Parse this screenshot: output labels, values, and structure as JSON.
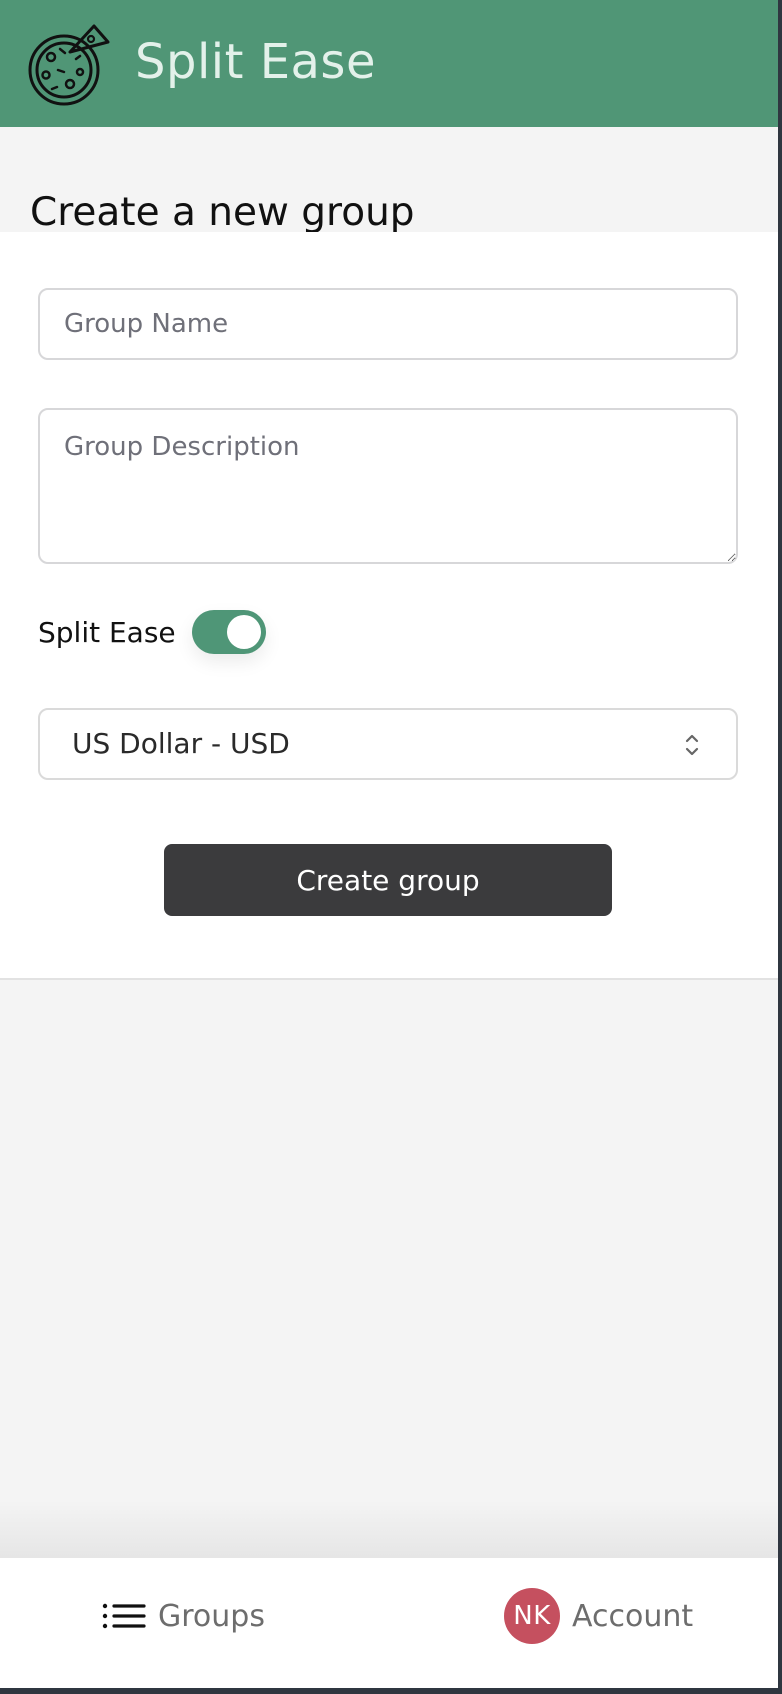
{
  "header": {
    "app_title": "Split Ease",
    "logo_icon": "pizza-icon"
  },
  "page": {
    "title": "Create a new group"
  },
  "form": {
    "group_name": {
      "placeholder": "Group Name",
      "value": ""
    },
    "group_description": {
      "placeholder": "Group Description",
      "value": ""
    },
    "toggle": {
      "label": "Split Ease",
      "checked": true
    },
    "currency": {
      "selected": "US Dollar - USD"
    },
    "create_label": "Create group"
  },
  "bottom_nav": {
    "groups_label": "Groups",
    "account_label": "Account",
    "avatar_initials": "NK"
  },
  "colors": {
    "header": "#509676",
    "accent": "#4f9677",
    "button": "#3b3b3d",
    "avatar": "#c5505f"
  }
}
